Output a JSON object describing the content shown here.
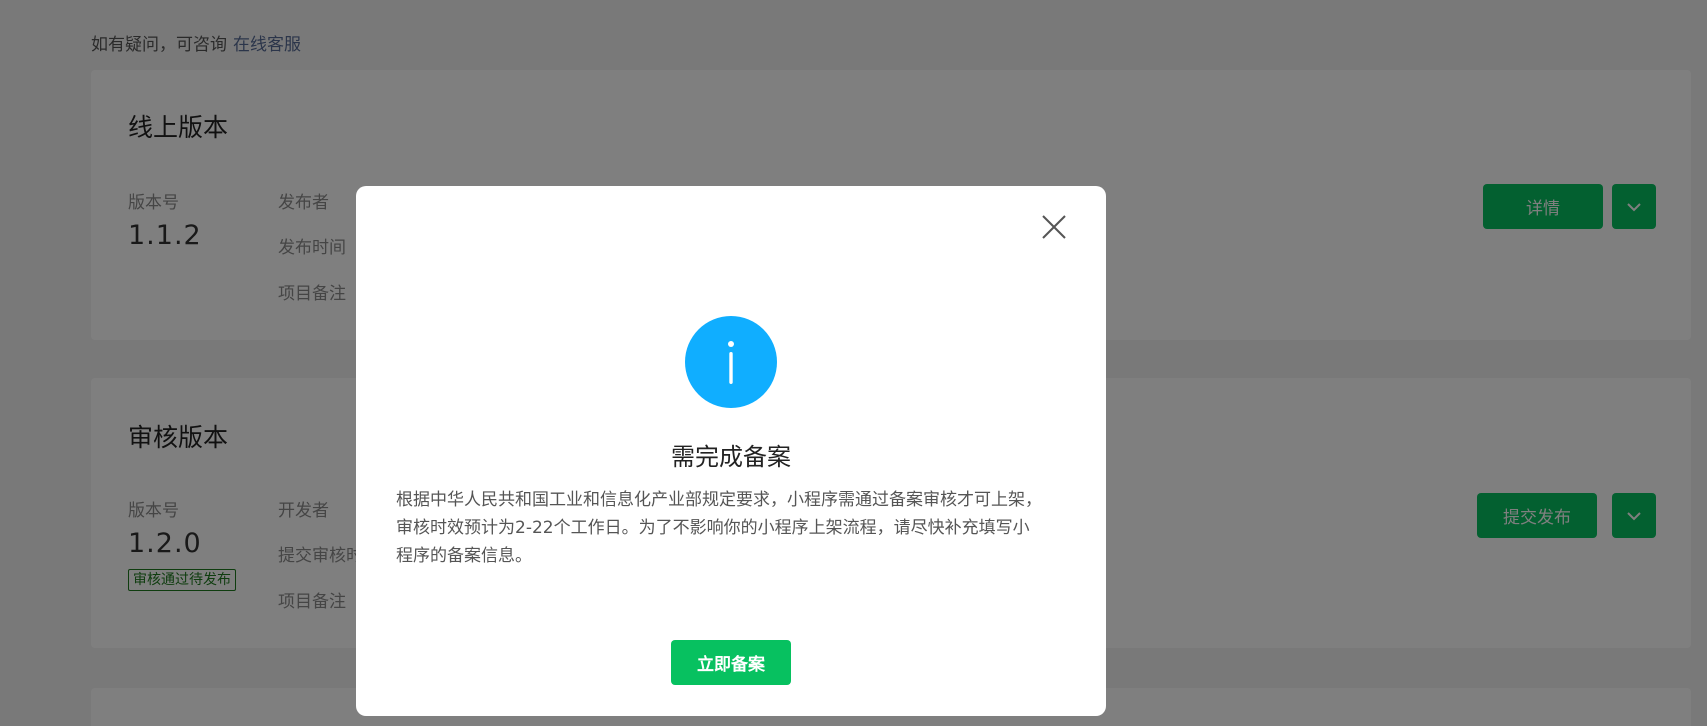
{
  "consult": {
    "text": "如有疑问，可咨询",
    "link": "在线客服"
  },
  "online_card": {
    "title": "线上版本",
    "version_label": "版本号",
    "version": "1.1.2",
    "meta_labels": [
      "发布者",
      "发布时间",
      "项目备注"
    ],
    "detail_button": "详情"
  },
  "review_card": {
    "title": "审核版本",
    "version_label": "版本号",
    "version": "1.2.0",
    "status_tag": "审核通过待发布",
    "meta_labels": [
      "开发者",
      "提交审核时",
      "项目备注"
    ],
    "submit_button": "提交发布"
  },
  "dialog": {
    "title": "需完成备案",
    "body_lines": [
      "根据中华人民共和国工业和信息化产业部规定要求，小程序需通过备案审核才可上架，",
      "审核时效预计为2-22个工作日。为了不影响你的小程序上架流程，请尽快补充填写小",
      "程序的备案信息。"
    ],
    "confirm_button": "立即备案"
  },
  "colors": {
    "primary": "#07c160",
    "info_icon": "#10aeff",
    "link": "#576b95",
    "mask": "rgba(0,0,0,0.5)"
  },
  "icons": {
    "close": "close-icon",
    "info": "info-icon",
    "dropdown": "chevron-down-icon"
  }
}
